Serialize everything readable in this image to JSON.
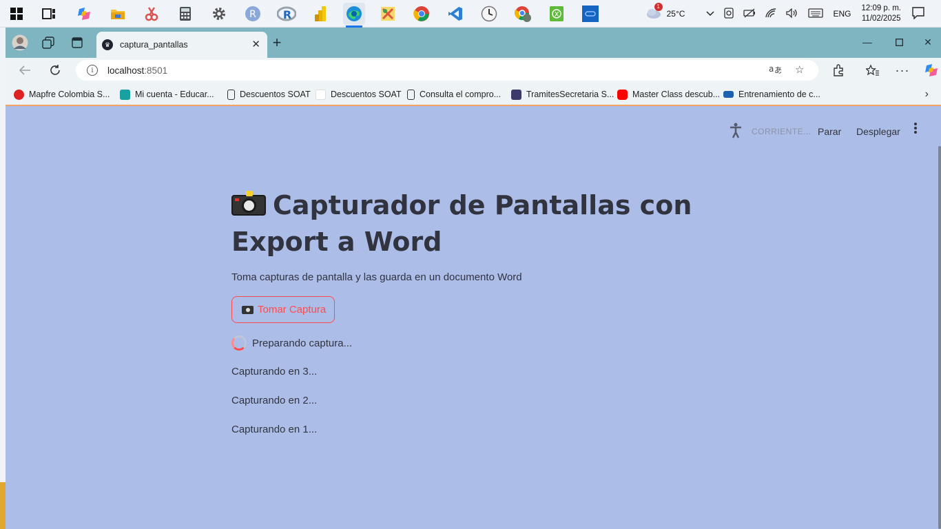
{
  "taskbar": {
    "apps": [
      {
        "name": "start-icon"
      },
      {
        "name": "task-view-icon"
      },
      {
        "name": "copilot-icon"
      },
      {
        "name": "file-explorer-icon"
      },
      {
        "name": "snipping-tool-icon"
      },
      {
        "name": "calculator-icon"
      },
      {
        "name": "settings-icon"
      },
      {
        "name": "r-gui-icon"
      },
      {
        "name": "rstudio-icon"
      },
      {
        "name": "power-bi-icon"
      },
      {
        "name": "edge-icon"
      },
      {
        "name": "tool-icon"
      },
      {
        "name": "chrome-icon"
      },
      {
        "name": "vscode-icon"
      },
      {
        "name": "clock-app-icon"
      },
      {
        "name": "chrome-profile-icon"
      },
      {
        "name": "excel-icon"
      },
      {
        "name": "remote-app-icon"
      }
    ],
    "weather": "25°C",
    "weather_badge": "1",
    "language": "ENG",
    "time": "12:09 p. m.",
    "date": "11/02/2025"
  },
  "browser": {
    "tab_title": "captura_pantallas",
    "url_host": "localhost",
    "url_port": ":8501",
    "favorites": [
      {
        "label": "Mapfre Colombia S...",
        "color": "#d22"
      },
      {
        "label": "Mi cuenta - Educar...",
        "color": "#19a1a1"
      },
      {
        "label": "Descuentos SOAT",
        "color": "#ffffff"
      },
      {
        "label": "Descuentos SOAT",
        "color": "#ffffff"
      },
      {
        "label": "Consulta el compro...",
        "color": "#ffffff"
      },
      {
        "label": "TramitesSecretaria S...",
        "color": "#3b3b6b"
      },
      {
        "label": "Master Class descub...",
        "color": "#ff0000"
      },
      {
        "label": "Entrenamiento de c...",
        "color": "#2060b0"
      }
    ]
  },
  "app": {
    "header": {
      "status": "CORRIENTE...",
      "stop_label": "Parar",
      "deploy_label": "Desplegar"
    },
    "title": "Capturador de Pantallas con Export a Word",
    "subtitle": "Toma capturas de pantalla y las guarda en un documento Word",
    "button_label": "Tomar Captura",
    "spinner_text": "Preparando captura...",
    "countdown": [
      "Capturando en 3...",
      "Capturando en 2...",
      "Capturando en 1..."
    ],
    "accent_color": "#ff4b4b",
    "background_color": "#acbde8"
  }
}
